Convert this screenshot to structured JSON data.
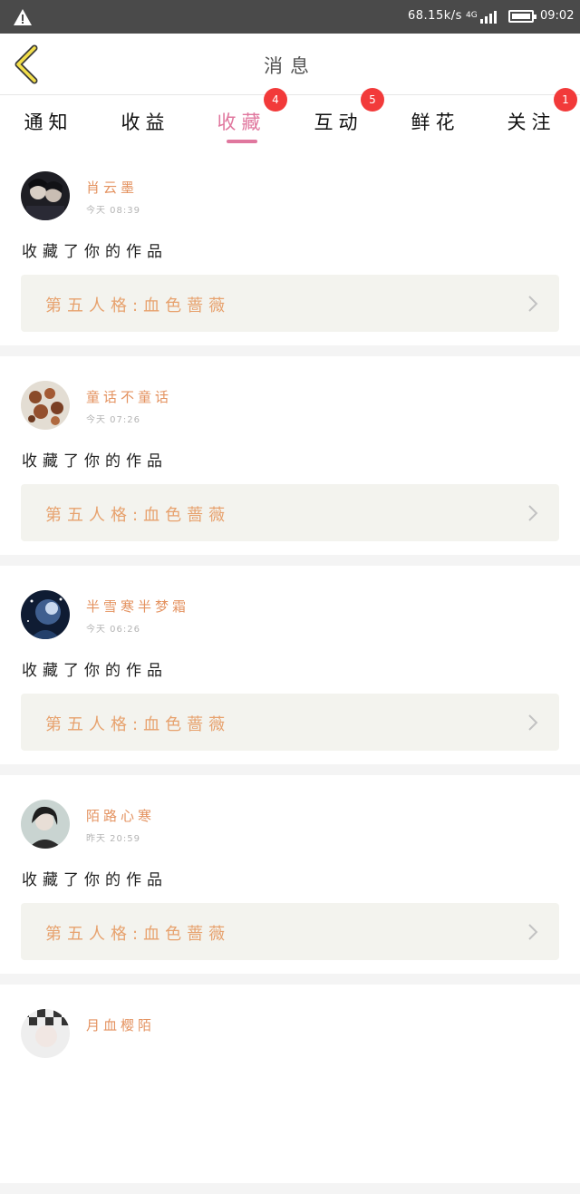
{
  "status_bar": {
    "speed": "68.15k/s",
    "network": "4G",
    "time": "09:02",
    "icons": [
      "warning-icon",
      "signal-icon",
      "battery-icon"
    ]
  },
  "header": {
    "title": "消息",
    "back_icon": "chevron-left-icon"
  },
  "tabs": [
    {
      "label": "通知",
      "badge": ""
    },
    {
      "label": "收益",
      "badge": ""
    },
    {
      "label": "收藏",
      "badge": "4",
      "active": true
    },
    {
      "label": "互动",
      "badge": "5"
    },
    {
      "label": "鲜花",
      "badge": ""
    },
    {
      "label": "关注",
      "badge": "1"
    }
  ],
  "colors": {
    "accent": "#e0779e",
    "username": "#e49361",
    "work_title": "#e7a26e",
    "badge": "#f23a3a",
    "work_bg": "#f3f3ee"
  },
  "notifications": [
    {
      "username": "肖云墨",
      "time": "今天 08:39",
      "action": "收藏了你的作品",
      "work_title": "第五人格:血色蔷薇"
    },
    {
      "username": "童话不童话",
      "time": "今天 07:26",
      "action": "收藏了你的作品",
      "work_title": "第五人格:血色蔷薇"
    },
    {
      "username": "半雪寒半梦霜",
      "time": "今天 06:26",
      "action": "收藏了你的作品",
      "work_title": "第五人格:血色蔷薇"
    },
    {
      "username": "陌路心寒",
      "time": "昨天 20:59",
      "action": "收藏了你的作品",
      "work_title": "第五人格:血色蔷薇"
    },
    {
      "username": "月血樱陌",
      "time": "",
      "action": "",
      "work_title": ""
    }
  ]
}
